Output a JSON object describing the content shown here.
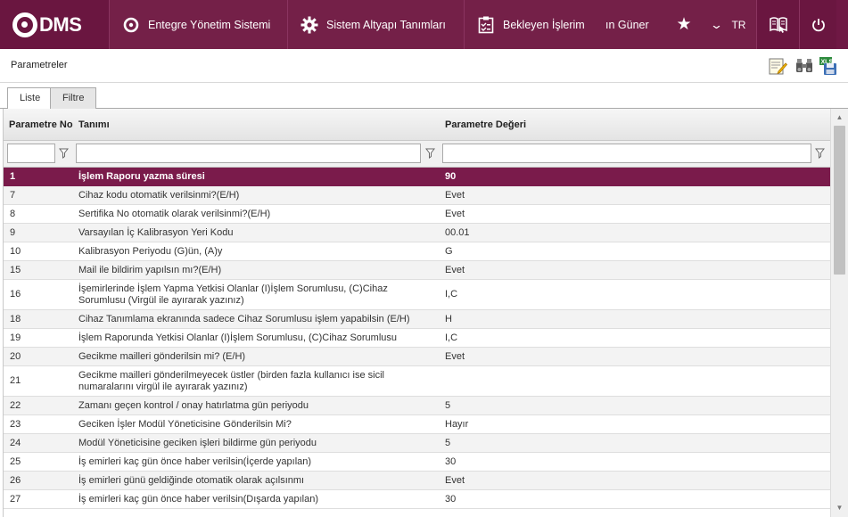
{
  "app": {
    "logo_text": "DMS",
    "nav": [
      {
        "label": "Entegre Yönetim Sistemi",
        "icon": "q-circle-icon"
      },
      {
        "label": "Sistem Altyapı Tanımları",
        "icon": "gear-icon"
      },
      {
        "label": "Bekleyen İşlerim",
        "icon": "clipboard-icon"
      }
    ],
    "user_name": "ın Güner",
    "language": "TR",
    "icons": {
      "favorites": "star-icon",
      "language_menu": "chevron-down-icon",
      "help": "book-icon",
      "logout": "power-icon"
    },
    "brand_color": "#6f1844"
  },
  "panel": {
    "title": "Parametreler",
    "tools": [
      "edit-note-icon",
      "binoculars-icon",
      "excel-export-icon"
    ]
  },
  "tabs": [
    {
      "label": "Liste",
      "active": true
    },
    {
      "label": "Filtre",
      "active": false
    }
  ],
  "grid": {
    "columns": [
      "Parametre No",
      "Tanımı",
      "Parametre Değeri"
    ],
    "filters": {
      "no": "",
      "tanim": "",
      "deger": ""
    },
    "selected_row_color": "#7a1b4b",
    "rows": [
      {
        "no": "1",
        "tanim": "İşlem Raporu yazma süresi",
        "deger": "90",
        "selected": true
      },
      {
        "no": "7",
        "tanim": "Cihaz kodu otomatik verilsinmi?(E/H)",
        "deger": "Evet"
      },
      {
        "no": "8",
        "tanim": "Sertifika No otomatik olarak verilsinmi?(E/H)",
        "deger": "Evet"
      },
      {
        "no": "9",
        "tanim": "Varsayılan İç Kalibrasyon Yeri Kodu",
        "deger": "00.01"
      },
      {
        "no": "10",
        "tanim": "Kalibrasyon Periyodu (G)ün, (A)y",
        "deger": "G"
      },
      {
        "no": "15",
        "tanim": "Mail ile bildirim yapılsın mı?(E/H)",
        "deger": "Evet"
      },
      {
        "no": "16",
        "tanim": "İşemirlerinde İşlem Yapma Yetkisi Olanlar (I)İşlem Sorumlusu, (C)Cihaz Sorumlusu (Virgül ile ayırarak yazınız)",
        "deger": "I,C",
        "tall": true
      },
      {
        "no": "18",
        "tanim": "Cihaz Tanımlama ekranında sadece Cihaz Sorumlusu işlem yapabilsin (E/H)",
        "deger": "H"
      },
      {
        "no": "19",
        "tanim": "İşlem Raporunda Yetkisi Olanlar (I)İşlem Sorumlusu, (C)Cihaz Sorumlusu",
        "deger": "I,C"
      },
      {
        "no": "20",
        "tanim": "Gecikme mailleri gönderilsin mi? (E/H)",
        "deger": "Evet"
      },
      {
        "no": "21",
        "tanim": "Gecikme mailleri gönderilmeyecek üstler (birden fazla kullanıcı ise sicil numaralarını virgül ile ayırarak yazınız)",
        "deger": "",
        "tall": true
      },
      {
        "no": "22",
        "tanim": "Zamanı geçen kontrol / onay hatırlatma gün periyodu",
        "deger": "5"
      },
      {
        "no": "23",
        "tanim": "Geciken İşler Modül Yöneticisine Gönderilsin Mi?",
        "deger": "Hayır"
      },
      {
        "no": "24",
        "tanim": "Modül Yöneticisine geciken işleri bildirme gün periyodu",
        "deger": "5"
      },
      {
        "no": "25",
        "tanim": "İş emirleri kaç gün önce haber verilsin(İçerde yapılan)",
        "deger": "30"
      },
      {
        "no": "26",
        "tanim": "İş emirleri günü geldiğinde otomatik olarak açılsınmı",
        "deger": "Evet"
      },
      {
        "no": "27",
        "tanim": "İş emirleri kaç gün önce haber verilsin(Dışarda yapılan)",
        "deger": "30"
      }
    ]
  }
}
